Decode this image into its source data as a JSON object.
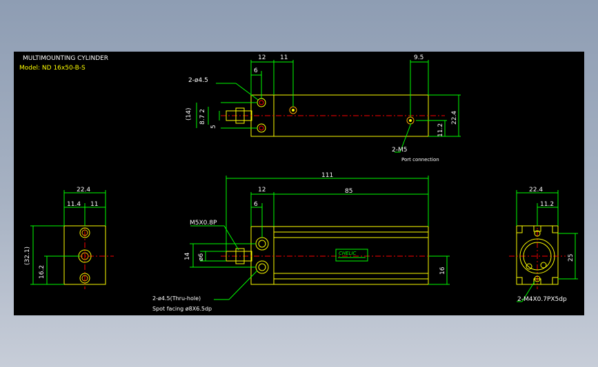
{
  "title": "MULTIMOUNTING CYLINDER",
  "model": "Model: ND 16x50-B-S",
  "colors": {
    "background": "#000000",
    "body": "#ffff00",
    "dimension": "#00ff00",
    "center_line": "#ff0000",
    "text": "#ffffff",
    "port": "#ffa500"
  },
  "top_view": {
    "dim_12": "12",
    "dim_11": "11",
    "dim_9_5": "9.5",
    "dim_6": "6",
    "dim_14": "(14)",
    "dim_8_7_2": "8.7 2",
    "dim_5": "5",
    "dim_11_2": "11.2",
    "dim_22_4": "22.4",
    "hole_callout": "2-ø4.5",
    "port_callout": "2-M5",
    "port_note": "Port connection"
  },
  "front_view": {
    "dim_111": "111",
    "dim_12": "12",
    "dim_85": "85",
    "dim_6": "6",
    "thread_callout": "M5X0.8P",
    "dim_14": "14",
    "dim_phi6": "ø6",
    "dim_16": "16",
    "hole_callout": "2-ø4.5(Thru-hole)",
    "counterbore_note": "Spot facing  ø8X6.5dp",
    "nameplate": "CHELIC"
  },
  "left_view": {
    "dim_22_4": "22.4",
    "dim_11_4": "11.4",
    "dim_11": "11",
    "dim_32_1": "(32.1)",
    "dim_16_2": "16.2"
  },
  "right_view": {
    "dim_22_4": "22.4",
    "dim_11_2": "11.2",
    "dim_25": "25",
    "tap_callout": "2-M4X0.7PX5dp"
  }
}
